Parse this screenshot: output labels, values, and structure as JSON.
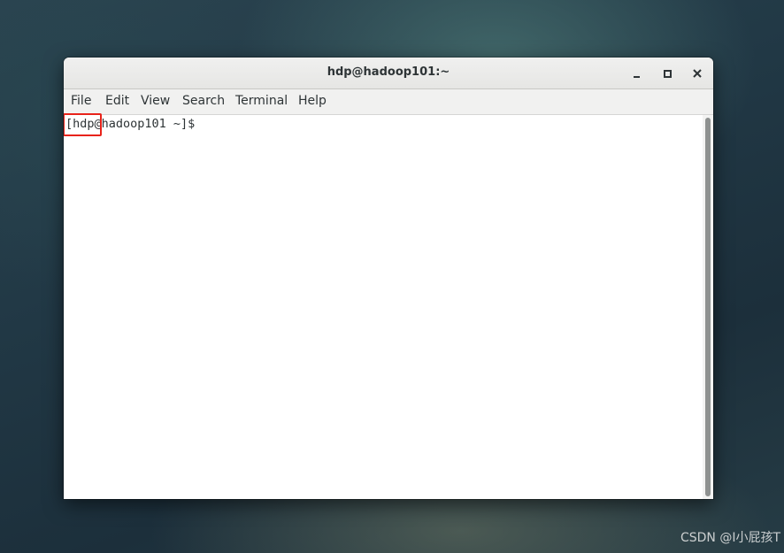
{
  "window": {
    "title": "hdp@hadoop101:~"
  },
  "menubar": {
    "items": [
      {
        "label": "File"
      },
      {
        "label": "Edit"
      },
      {
        "label": "View"
      },
      {
        "label": "Search"
      },
      {
        "label": "Terminal"
      },
      {
        "label": "Help"
      }
    ]
  },
  "terminal": {
    "prompt": "[hdp@hadoop101 ~]$"
  },
  "icons": {
    "minimize": "minimize-icon",
    "maximize": "maximize-icon",
    "close": "close-icon"
  },
  "colors": {
    "highlight": "#e8231a",
    "text": "#2e3436"
  },
  "watermark": {
    "text": "CSDN @I小屁孩T"
  }
}
